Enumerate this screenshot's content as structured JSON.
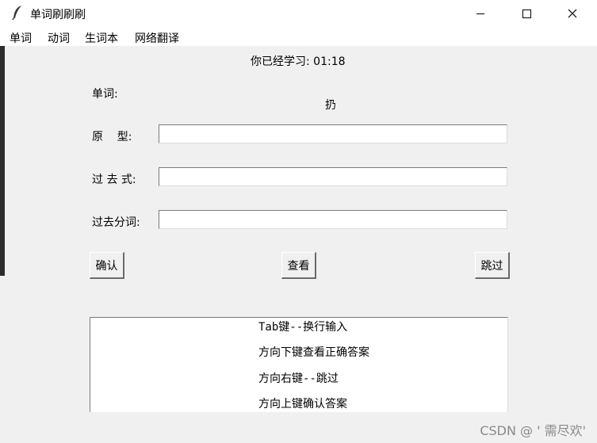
{
  "window": {
    "title": "单词刷刷刷",
    "controls": [
      "minimize-icon",
      "maximize-icon",
      "close-icon"
    ]
  },
  "menu": [
    "单词",
    "动词",
    "生词本",
    "网络翻译"
  ],
  "timer": "你已经学习: 01:18",
  "form": {
    "word_label": "单词:",
    "word_value": "扔",
    "base_label": "原    型:",
    "base_value": "",
    "past_label": "过 去 式:",
    "past_value": "",
    "pp_label": "过去分词:",
    "pp_value": ""
  },
  "buttons": {
    "confirm": "确认",
    "view": "查看",
    "skip": "跳过"
  },
  "hints": [
    "Tab键--换行输入",
    "方向下键查看正确答案",
    "方向右键--跳过",
    "方向上键确认答案"
  ],
  "watermark": "CSDN @ ' 需尽欢'"
}
